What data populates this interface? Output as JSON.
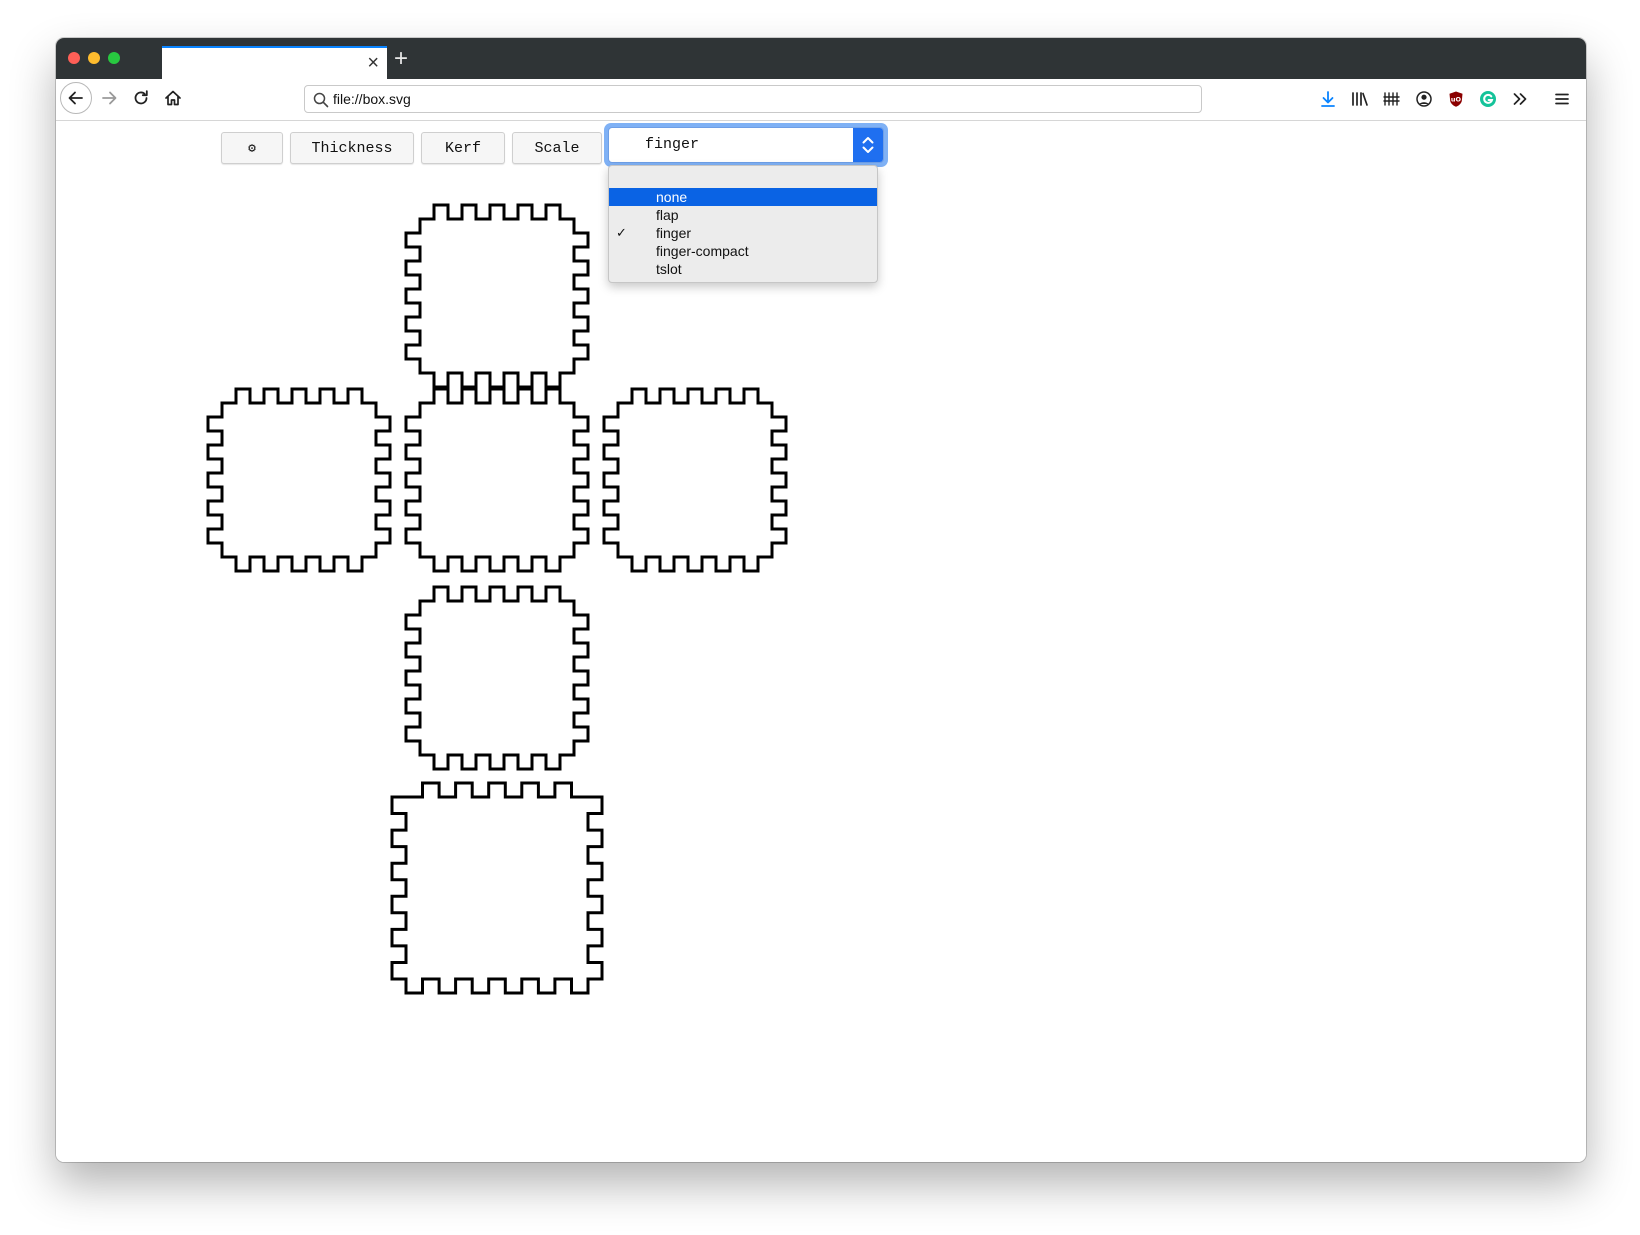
{
  "browser": {
    "url": "file://box.svg",
    "tab_close": "×",
    "new_tab": "+"
  },
  "toolbar": {
    "settings_label": "⚙",
    "thickness_label": "Thickness",
    "kerf_label": "Kerf",
    "scale_label": "Scale",
    "joint_select_value": "finger"
  },
  "joint_menu": {
    "options": [
      {
        "label": "none",
        "highlighted": true,
        "checked": false
      },
      {
        "label": "flap",
        "highlighted": false,
        "checked": false
      },
      {
        "label": "finger",
        "highlighted": false,
        "checked": true
      },
      {
        "label": "finger-compact",
        "highlighted": false,
        "checked": false
      },
      {
        "label": "tslot",
        "highlighted": false,
        "checked": false
      }
    ],
    "check_mark": "✓"
  },
  "colors": {
    "accent": "#0a84ff",
    "menu_highlight": "#0a63e4",
    "select_focus_ring": "#7fb1f5",
    "ublock": "#8b0000",
    "grammarly": "#15c39a"
  },
  "icons": [
    "back-arrow-icon",
    "forward-arrow-icon",
    "reload-icon",
    "home-icon",
    "search-icon",
    "download-icon",
    "library-icon",
    "sidebar-icon",
    "account-icon",
    "ublock-icon",
    "grammarly-icon",
    "overflow-icon",
    "hamburger-menu-icon"
  ]
}
